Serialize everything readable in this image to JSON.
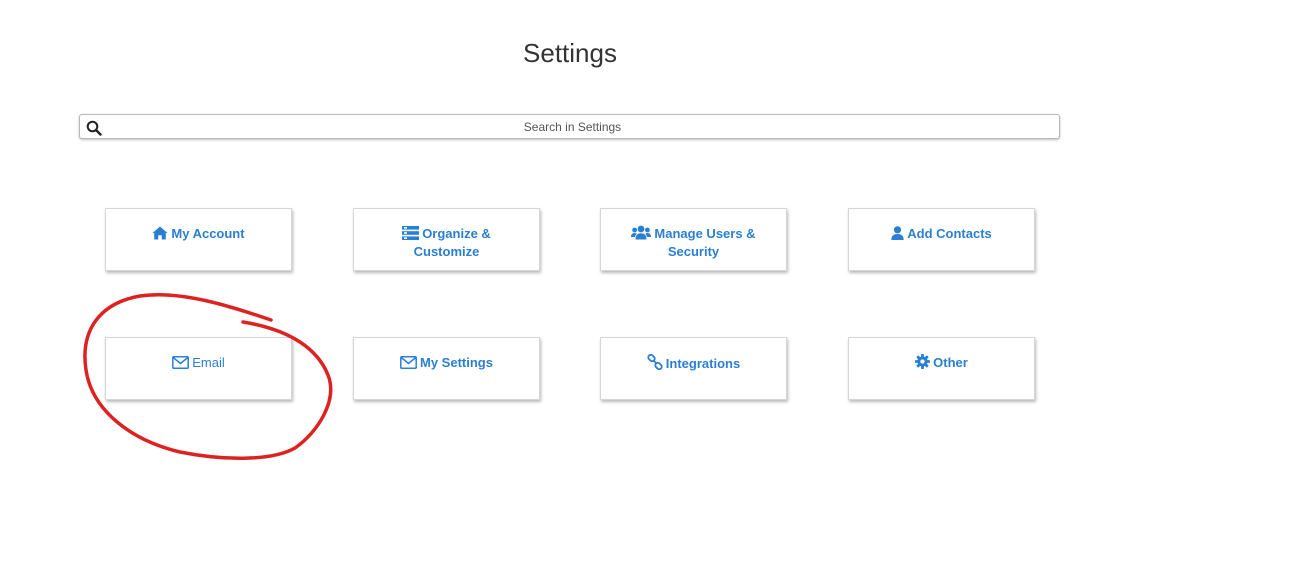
{
  "page": {
    "title": "Settings"
  },
  "search": {
    "placeholder": "Search in Settings",
    "icon": "search-icon"
  },
  "theme": {
    "accent": "#2a7fd3",
    "annotation": "#dd2222"
  },
  "tiles": [
    {
      "label_line1": "My Account",
      "label_line2": "",
      "icon": "home-icon"
    },
    {
      "label_line1": "Organize &",
      "label_line2": "Customize",
      "icon": "list-icon"
    },
    {
      "label_line1": "Manage Users &",
      "label_line2": "Security",
      "icon": "users-icon"
    },
    {
      "label_line1": "Add Contacts",
      "label_line2": "",
      "icon": "user-icon"
    },
    {
      "label_line1": "Email",
      "label_line2": "",
      "icon": "envelope-icon"
    },
    {
      "label_line1": "My Settings",
      "label_line2": "",
      "icon": "envelope-icon"
    },
    {
      "label_line1": "Integrations",
      "label_line2": "",
      "icon": "link-icon"
    },
    {
      "label_line1": "Other",
      "label_line2": "",
      "icon": "gear-icon"
    }
  ]
}
